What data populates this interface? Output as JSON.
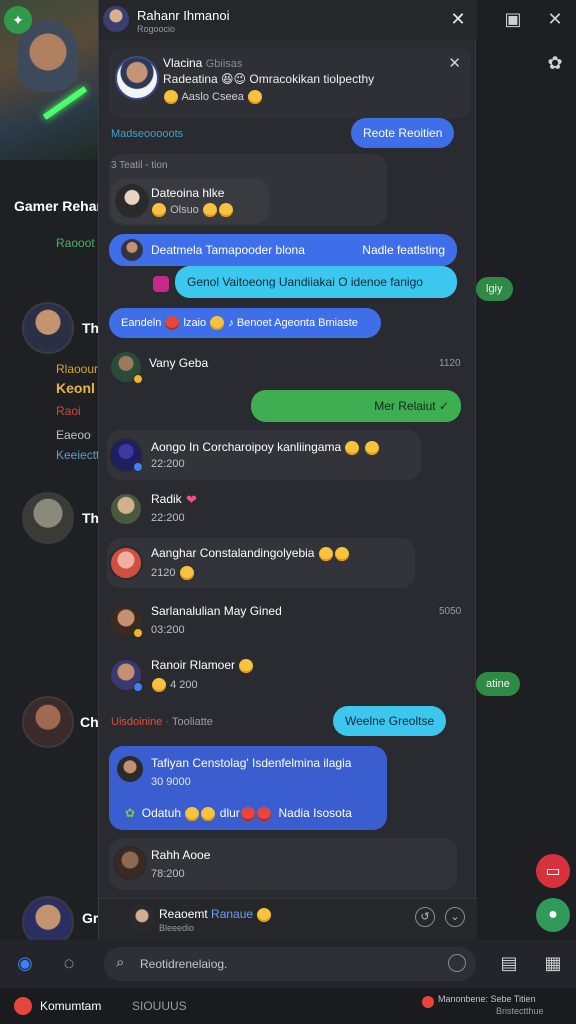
{
  "panel": {
    "header_title": "Rahanr Ihmanoi",
    "header_sub": "Rogoocio"
  },
  "card": {
    "name": "Vlacina",
    "name_tag": "Gbiisas",
    "line": "Radeatina 😆😉 Omracokikan tiolpecthy",
    "meta": "Aaslo Cseea"
  },
  "labels": {
    "section1": "Madseooooots",
    "date1": "3 Teatil - tion",
    "section2": "Uisdoinine",
    "section2b": "Tooliatte"
  },
  "buttons": {
    "reply_top": "Reote Reoitien",
    "reply_mid": "Weelne Greoltse"
  },
  "bubbles": {
    "deanna_name": "Dateoina hlke",
    "deanna_meta": "Olsuo",
    "blue_row": "Deatmela Tamapooder blona",
    "blue_row_right": "Nadle featlsting",
    "cyan_row": "Genol Vaitoeong Uandiiakai O idenoe fanigo",
    "mini_row": "Eandeln",
    "mini_row_mid": "lzaio",
    "mini_row_right": "Benoet Ageonta Bmiaste",
    "vany_name": "Vany Geba",
    "green_msg": "Mer Relaiut",
    "tafiyan_name": "Tafiyan Censtolag' Isdenfelmina ilagia",
    "tafiyan_time": "30 9000",
    "tafiyan_line": "Odatuh",
    "tafiyan_mid": "dlur",
    "tafiyan_right": "Nadia Isosota",
    "rahh_name": "Rahh Aooe",
    "rahh_time": "78:200"
  },
  "rows": [
    {
      "name": "Aongo In Corcharoipoy kanliingama",
      "time": "22:200"
    },
    {
      "name": "Radik",
      "time": "22:200"
    },
    {
      "name": "Aanghar Constalandingolyebia",
      "time": "2120"
    },
    {
      "name": "Sarlanalulian May Gined",
      "time": "03:200"
    },
    {
      "name": "Ranoir Rlamoer",
      "time": "4 200"
    }
  ],
  "times": {
    "vany": "1120",
    "sarla": "5050"
  },
  "panel_foot": {
    "name": "Reaoemt",
    "name_accent": "Ranaue",
    "sub": "Bleeedio"
  },
  "background": {
    "title": "Gamer Rehar",
    "sub": "Raooot",
    "row1_name": "Th",
    "row1_line1": "Rlaoour",
    "row1_line2": "Keonl",
    "row1_line3": "Raoi",
    "row1_line4": "Eaeoo",
    "row1_line5": "Keeiectt",
    "row2_name": "Th",
    "row3_name": "Ch",
    "row4_name": "Gr",
    "pill1": "lgiy",
    "pill2": "atine"
  },
  "search": {
    "placeholder": "Reotidrenelaiog."
  },
  "status": {
    "left": "Komumtam",
    "mid": "SIOUUUS",
    "right_top": "Manonbene: Sebe Titien",
    "right_bottom": "Bristectthue"
  },
  "colors": {
    "blue": "#3e6ee8",
    "cyan": "#3cc7ef",
    "green": "#3fae52",
    "panel": "#2a2b30"
  }
}
